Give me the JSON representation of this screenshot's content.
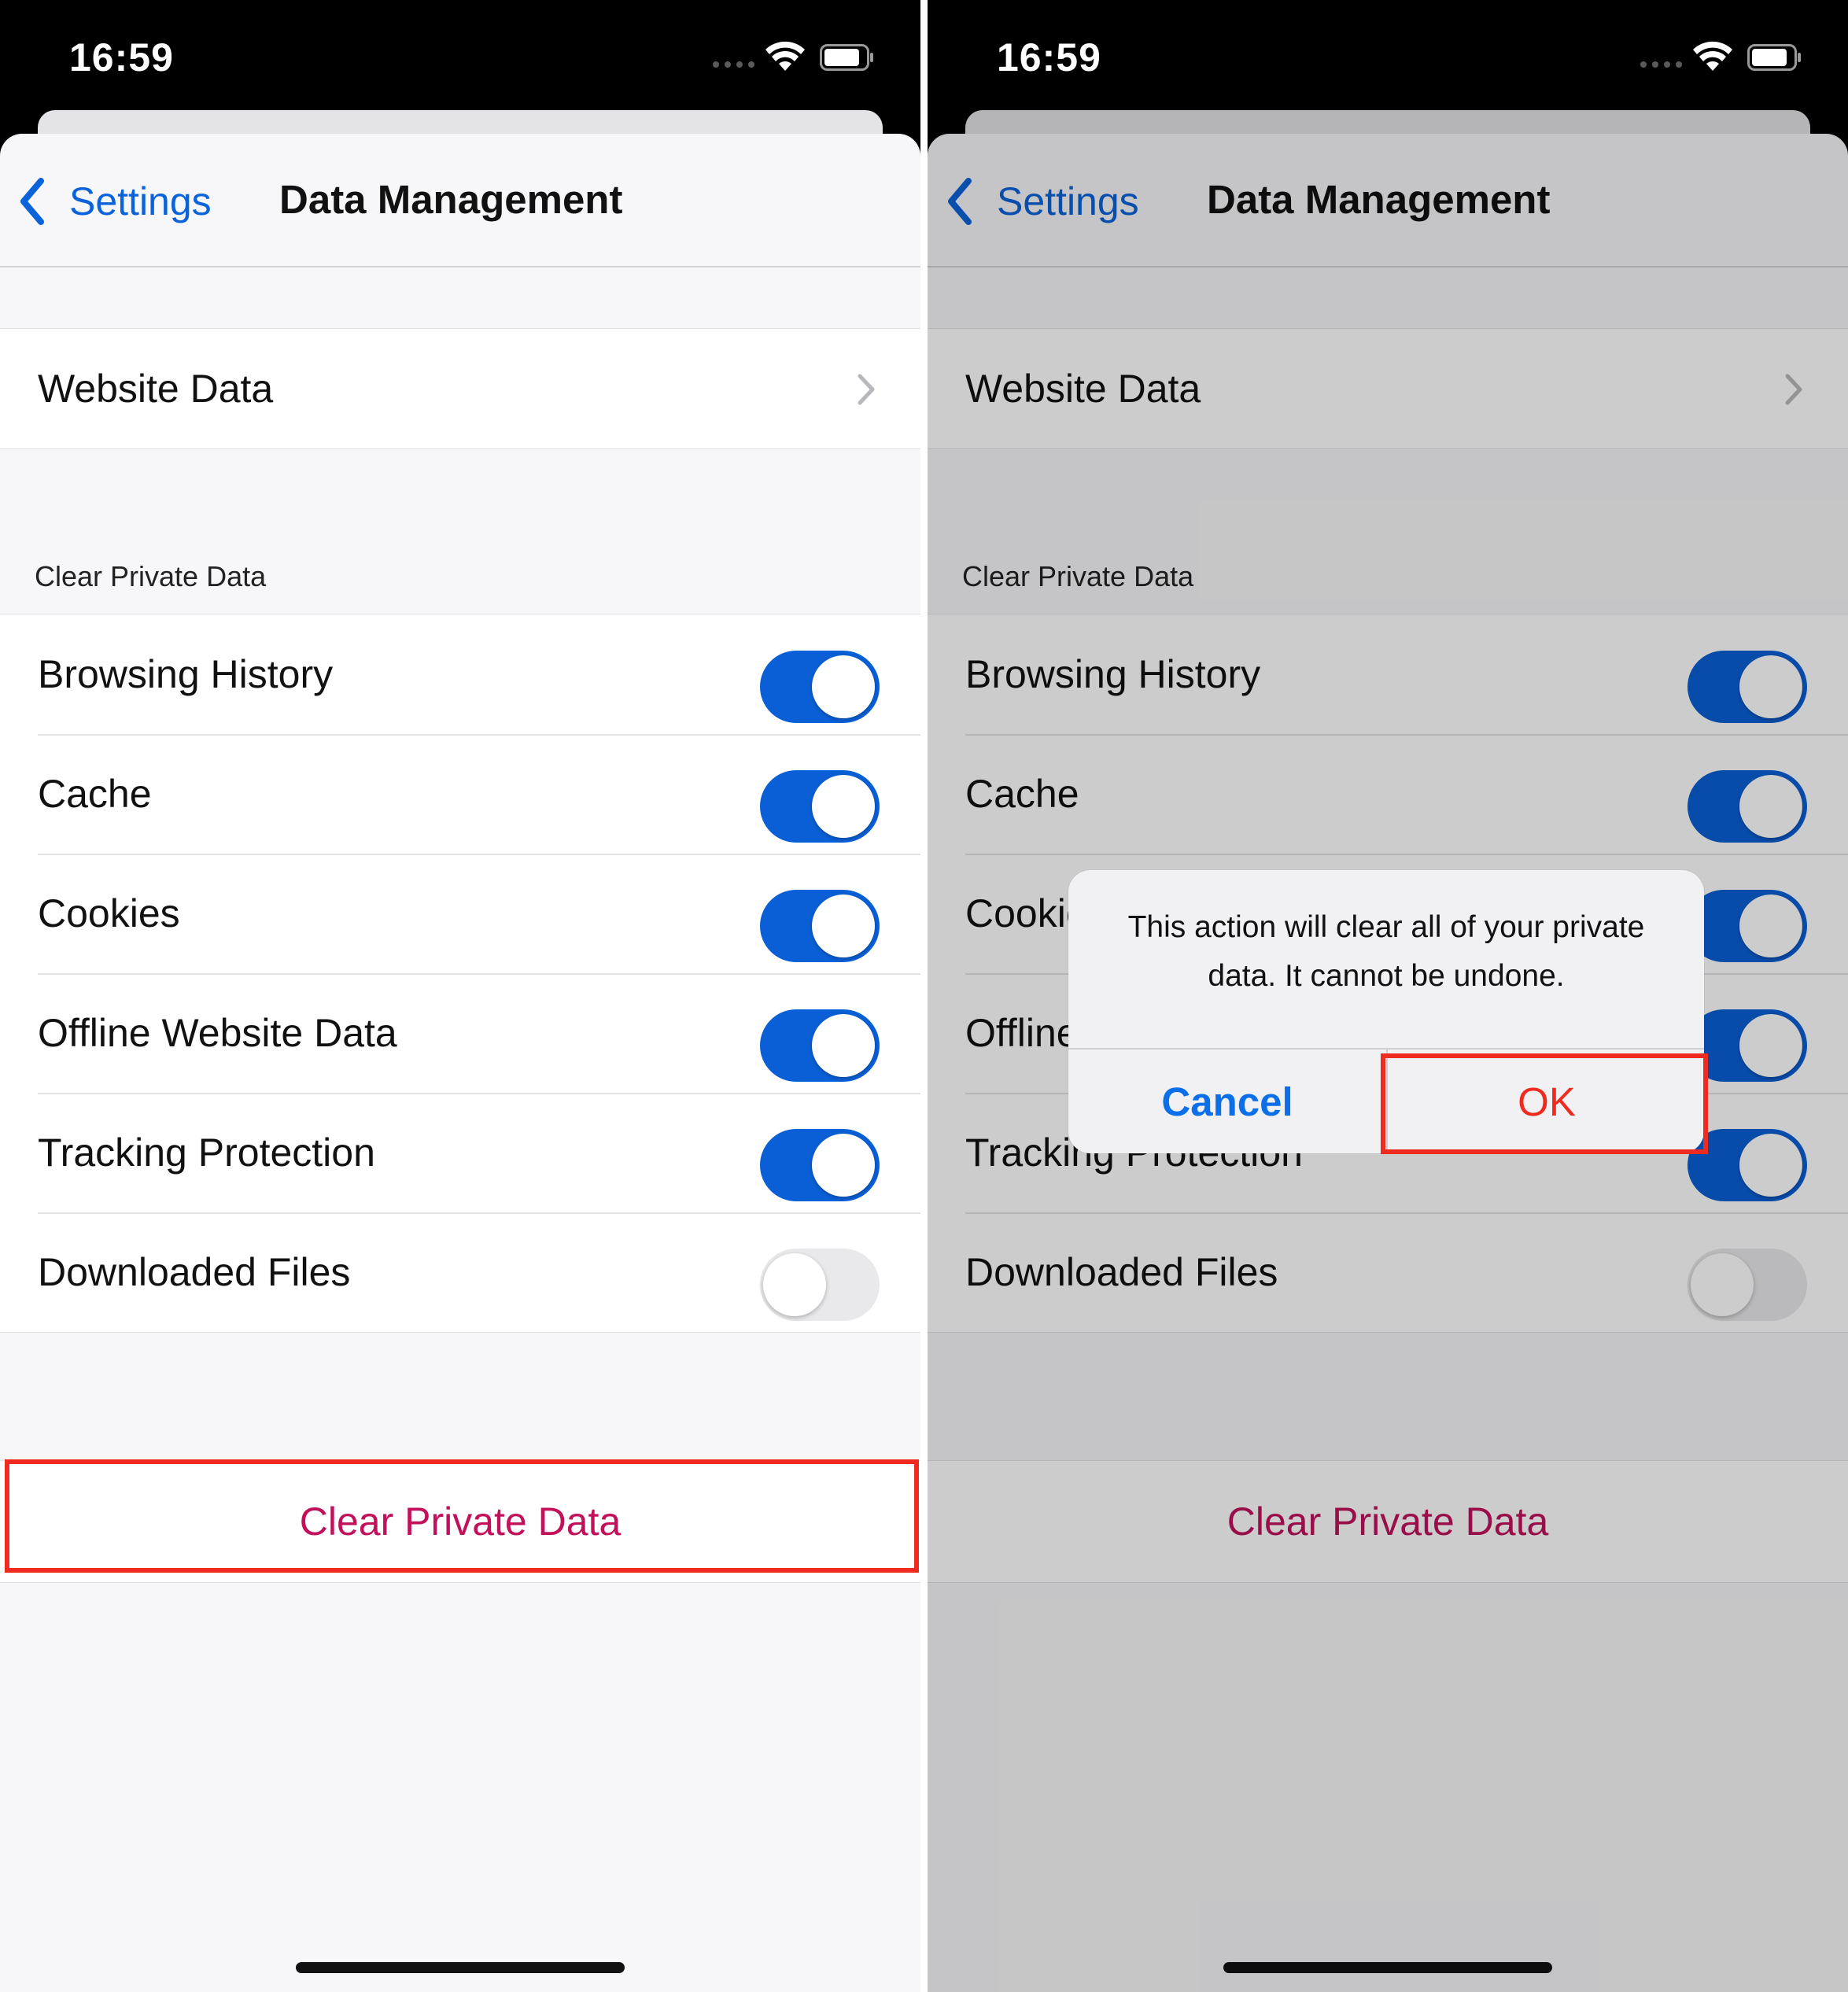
{
  "status_bar": {
    "time": "16:59"
  },
  "nav": {
    "back_label": "Settings",
    "title": "Data Management"
  },
  "website_data": {
    "label": "Website Data"
  },
  "clear_section": {
    "header": "Clear Private Data",
    "items": [
      {
        "label": "Browsing History",
        "enabled": true
      },
      {
        "label": "Cache",
        "enabled": true
      },
      {
        "label": "Cookies",
        "enabled": true
      },
      {
        "label": "Offline Website Data",
        "enabled": true
      },
      {
        "label": "Tracking Protection",
        "enabled": true
      },
      {
        "label": "Downloaded Files",
        "enabled": false
      }
    ]
  },
  "clear_button": {
    "label": "Clear Private Data"
  },
  "alert": {
    "message": "This action will clear all of your private data. It cannot be undone.",
    "cancel_label": "Cancel",
    "ok_label": "OK"
  },
  "colors": {
    "accent_blue": "#0a5fd6",
    "destructive": "#c0115a",
    "highlight": "#ef2a1f",
    "toggle_off": "#e9e9eb"
  }
}
